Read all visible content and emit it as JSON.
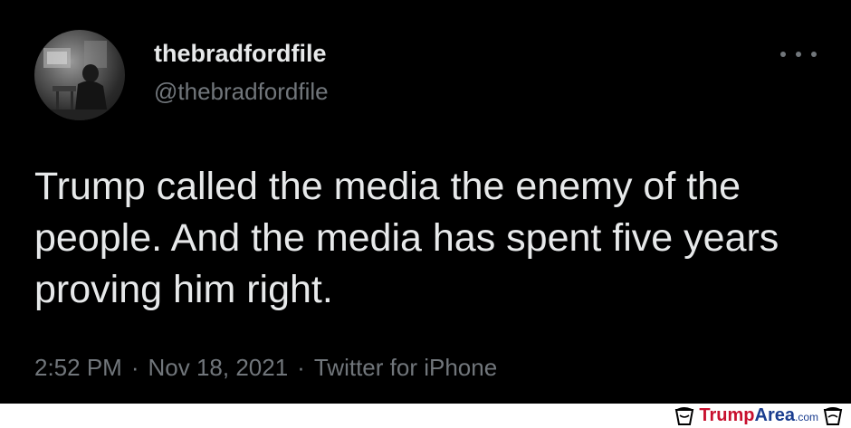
{
  "tweet": {
    "display_name": "thebradfordfile",
    "handle": "@thebradfordfile",
    "more_icon": "more-horizontal-icon",
    "text": "Trump called the media the enemy of the people. And the media has spent five years proving him right.",
    "time": "2:52 PM",
    "date": "Nov 18, 2021",
    "source": "Twitter for iPhone",
    "separator": "·"
  },
  "footer": {
    "brand_part1": "Trump",
    "brand_part2": "Area",
    "brand_suffix": ".com",
    "colors": {
      "trump": "#c8102e",
      "area": "#1a3d8f"
    }
  },
  "colors": {
    "background": "#000000",
    "primary_text": "#e7e9ea",
    "secondary_text": "#71767b"
  }
}
